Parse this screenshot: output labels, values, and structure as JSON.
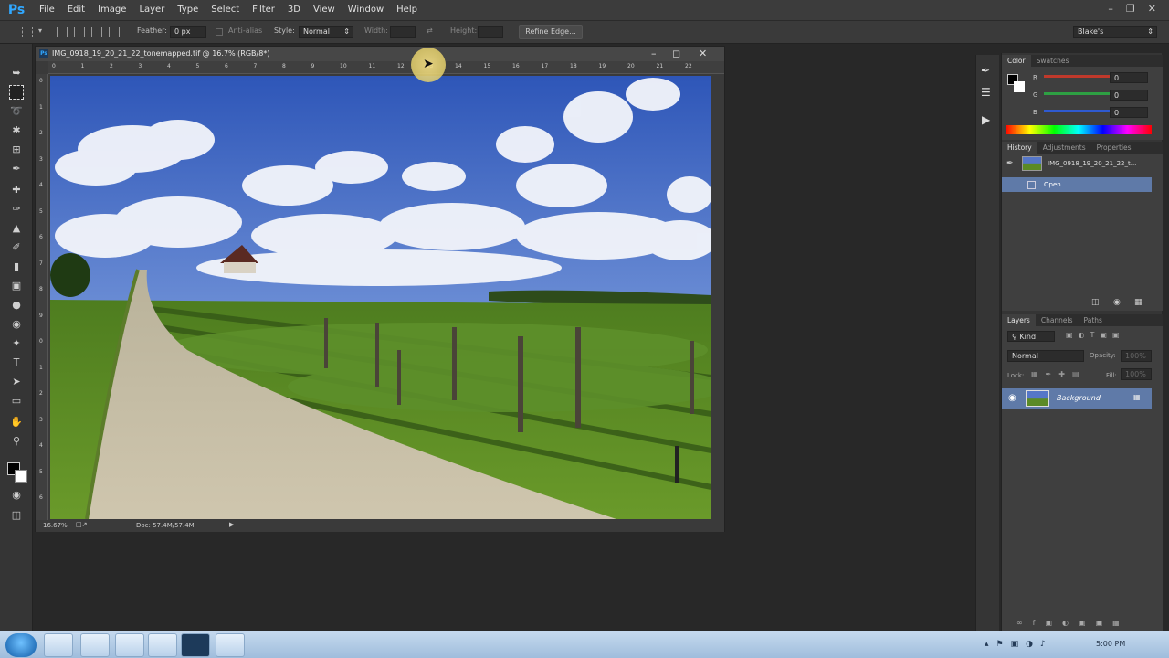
{
  "app": {
    "logo": "Ps"
  },
  "menu": [
    "File",
    "Edit",
    "Image",
    "Layer",
    "Type",
    "Select",
    "Filter",
    "3D",
    "View",
    "Window",
    "Help"
  ],
  "options": {
    "feather_label": "Feather:",
    "feather_value": "0 px",
    "antialias_label": "Anti-alias",
    "style_label": "Style:",
    "style_value": "Normal",
    "width_label": "Width:",
    "height_label": "Height:",
    "refine_edge": "Refine Edge...",
    "workspace": "Blake's"
  },
  "document": {
    "title": "IMG_0918_19_20_21_22_tonemapped.tif @ 16.7% (RGB/8*)",
    "zoom": "16.67%",
    "doc_size": "Doc: 57.4M/57.4M",
    "hruler_ticks": [
      "0",
      "1",
      "2",
      "3",
      "4",
      "5",
      "6",
      "7",
      "8",
      "9",
      "10",
      "11",
      "12",
      "13",
      "14",
      "15",
      "16",
      "17",
      "18",
      "19",
      "20",
      "21",
      "22"
    ],
    "vruler_ticks": [
      "0",
      "1",
      "2",
      "3",
      "4",
      "5",
      "6",
      "7",
      "8",
      "9",
      "0",
      "1",
      "2",
      "3",
      "4",
      "5",
      "6"
    ]
  },
  "color_panel": {
    "tabs": [
      "Color",
      "Swatches"
    ],
    "r_label": "R",
    "g_label": "G",
    "b_label": "B",
    "r_value": "0",
    "g_value": "0",
    "b_value": "0",
    "colors": {
      "r": "#c0392b",
      "g": "#2ea043",
      "b": "#2f5ad1"
    }
  },
  "history_panel": {
    "tabs": [
      "History",
      "Adjustments",
      "Properties"
    ],
    "snapshot_name": "IMG_0918_19_20_21_22_t...",
    "steps": [
      "Open"
    ]
  },
  "layers_panel": {
    "tabs": [
      "Layers",
      "Channels",
      "Paths"
    ],
    "kind_label": "Kind",
    "blend_mode": "Normal",
    "opacity_label": "Opacity:",
    "opacity_value": "100%",
    "lock_label": "Lock:",
    "fill_label": "Fill:",
    "fill_value": "100%",
    "layers": [
      {
        "name": "Background",
        "locked": true,
        "visible": true
      }
    ]
  },
  "taskbar": {
    "clock": "5:00 PM"
  }
}
